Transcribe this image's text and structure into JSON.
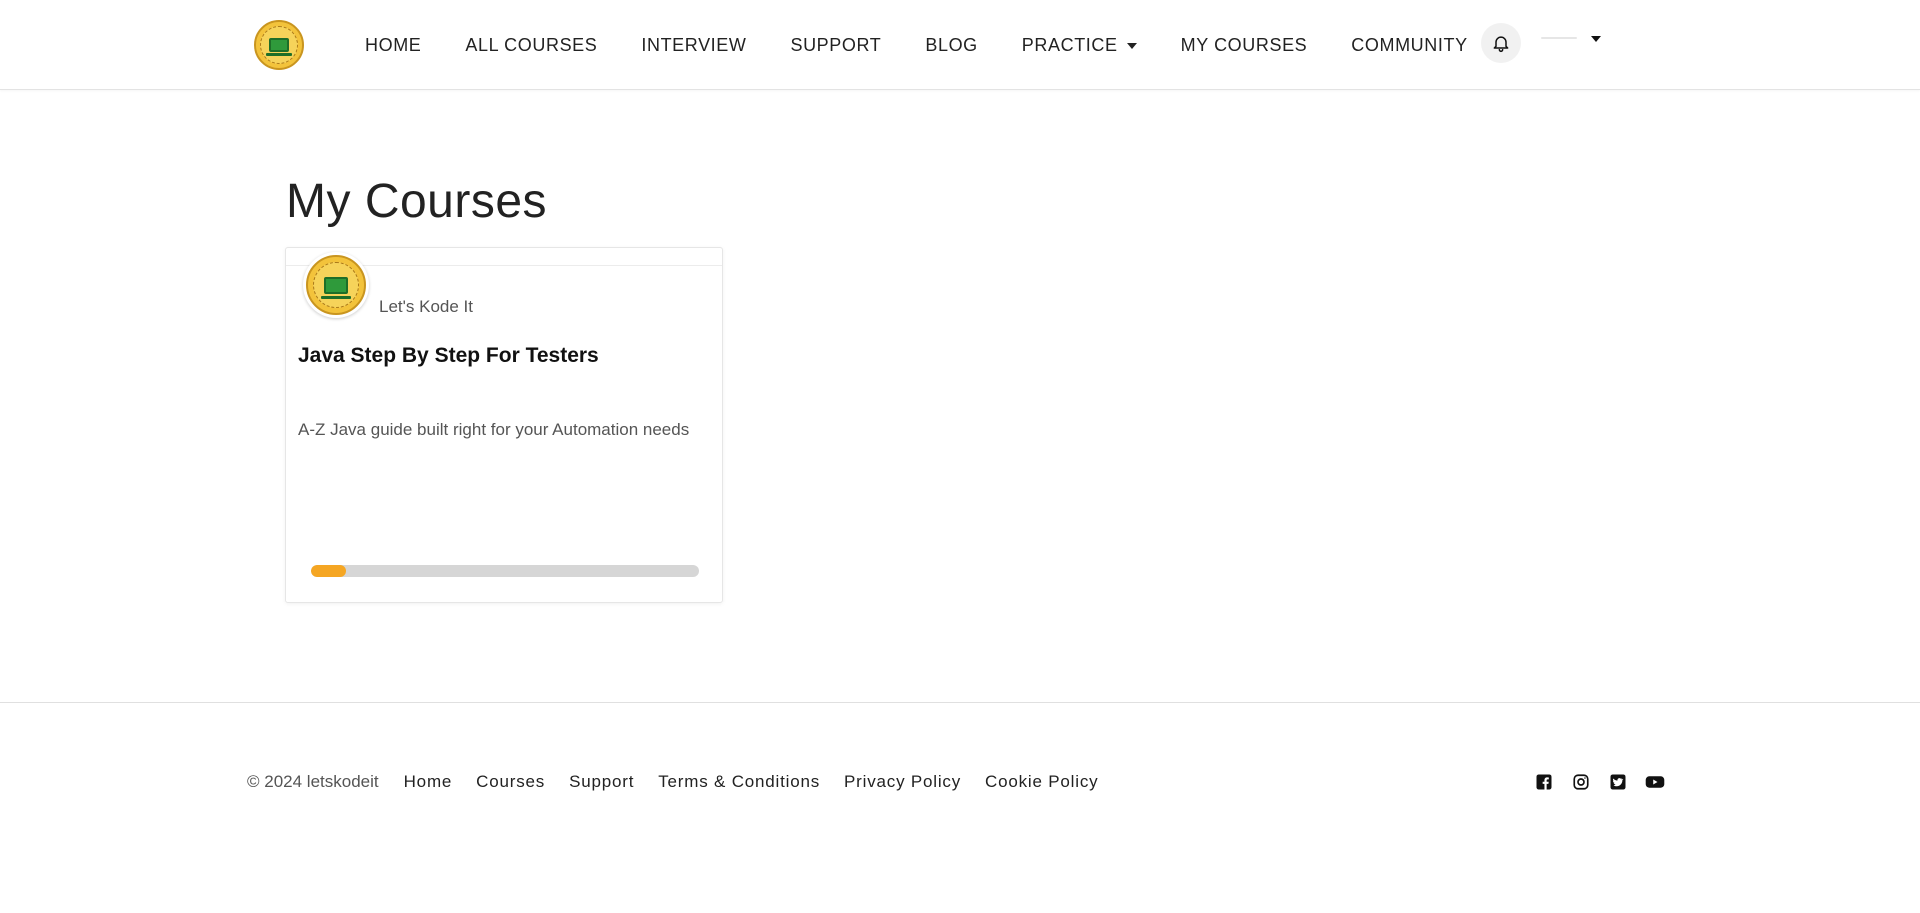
{
  "header": {
    "logo_icon": "letskodeit-logo-icon",
    "nav": [
      {
        "label": "HOME"
      },
      {
        "label": "ALL COURSES"
      },
      {
        "label": "INTERVIEW"
      },
      {
        "label": "SUPPORT"
      },
      {
        "label": "BLOG"
      },
      {
        "label": "PRACTICE",
        "has_dropdown": true
      },
      {
        "label": "MY COURSES"
      },
      {
        "label": "COMMUNITY"
      }
    ],
    "notification_icon": "bell-icon",
    "user_menu_icon": "caret-down-icon"
  },
  "main": {
    "title": "My Courses",
    "courses": [
      {
        "author": "Let's Kode It",
        "title": "Java Step By Step For Testers",
        "description": "A-Z Java guide built right for your Automation needs",
        "progress": 0.09
      }
    ]
  },
  "footer": {
    "copyright": "© 2024 letskodeit",
    "links": [
      {
        "label": "Home"
      },
      {
        "label": "Courses"
      },
      {
        "label": "Support"
      },
      {
        "label": "Terms & Conditions"
      },
      {
        "label": "Privacy Policy"
      },
      {
        "label": "Cookie Policy"
      }
    ],
    "social": [
      "facebook-icon",
      "instagram-icon",
      "twitter-icon",
      "youtube-icon"
    ]
  },
  "colors": {
    "accent": "#f5a623",
    "progress_track": "#d6d6d6",
    "logo_gold": "#f3c33b",
    "logo_green": "#2f9a3b"
  }
}
